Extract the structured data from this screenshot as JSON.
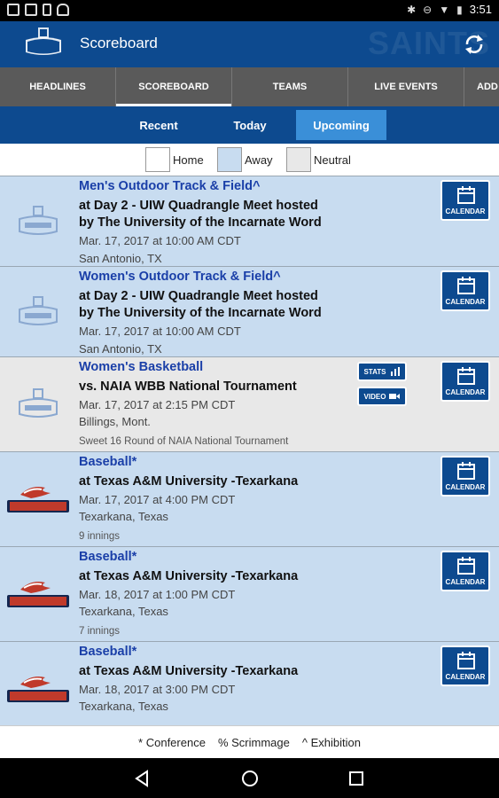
{
  "status_bar": {
    "time": "3:51"
  },
  "app_bar": {
    "title": "Scoreboard",
    "watermark": "SAINTS"
  },
  "tabs": [
    {
      "label": "HEADLINES"
    },
    {
      "label": "SCOREBOARD"
    },
    {
      "label": "TEAMS"
    },
    {
      "label": "LIVE EVENTS"
    },
    {
      "label": "ADD"
    }
  ],
  "subtabs": [
    {
      "label": "Recent"
    },
    {
      "label": "Today"
    },
    {
      "label": "Upcoming"
    }
  ],
  "legend": [
    {
      "label": "Home",
      "color": "#ffffff"
    },
    {
      "label": "Away",
      "color": "#c8dcf0"
    },
    {
      "label": "Neutral",
      "color": "#e8e8e8"
    }
  ],
  "events": [
    {
      "sport": "Men's Outdoor Track & Field^",
      "opponent": "at Day 2 - UIW Quadrangle Meet hosted by The University of the Incarnate Word",
      "datetime": "Mar. 17, 2017 at 10:00 AM CDT",
      "location": "San Antonio, TX",
      "note": "",
      "logo": "saints-logo",
      "calendar_label": "CALENDAR"
    },
    {
      "sport": "Women's Outdoor Track & Field^",
      "opponent": "at Day 2 - UIW Quadrangle Meet hosted by The University of the Incarnate Word",
      "datetime": "Mar. 17, 2017 at 10:00 AM CDT",
      "location": "San Antonio, TX",
      "note": "",
      "logo": "saints-logo",
      "calendar_label": "CALENDAR"
    },
    {
      "sport": "Women's Basketball",
      "opponent": "vs. NAIA WBB National Tournament",
      "datetime": "Mar. 17, 2017 at 2:15 PM CDT",
      "location": "Billings, Mont.",
      "note": "Sweet 16 Round of NAIA National Tournament",
      "logo": "saints-logo",
      "calendar_label": "CALENDAR",
      "stats_label": "STATS",
      "video_label": "VIDEO"
    },
    {
      "sport": "Baseball*",
      "opponent": "at Texas A&M University -Texarkana",
      "datetime": "Mar. 17, 2017 at 4:00 PM CDT",
      "location": "Texarkana, Texas",
      "note": "9 innings",
      "logo": "eagles-logo",
      "calendar_label": "CALENDAR"
    },
    {
      "sport": "Baseball*",
      "opponent": "at Texas A&M University -Texarkana",
      "datetime": "Mar. 18, 2017 at 1:00 PM CDT",
      "location": "Texarkana, Texas",
      "note": "7 innings",
      "logo": "eagles-logo",
      "calendar_label": "CALENDAR"
    },
    {
      "sport": "Baseball*",
      "opponent": "at Texas A&M University -Texarkana",
      "datetime": "Mar. 18, 2017 at 3:00 PM CDT",
      "location": "Texarkana, Texas",
      "note": "",
      "logo": "eagles-logo",
      "calendar_label": "CALENDAR"
    }
  ],
  "footer": {
    "conference": "* Conference",
    "scrimmage": "% Scrimmage",
    "exhibition": "^ Exhibition"
  }
}
